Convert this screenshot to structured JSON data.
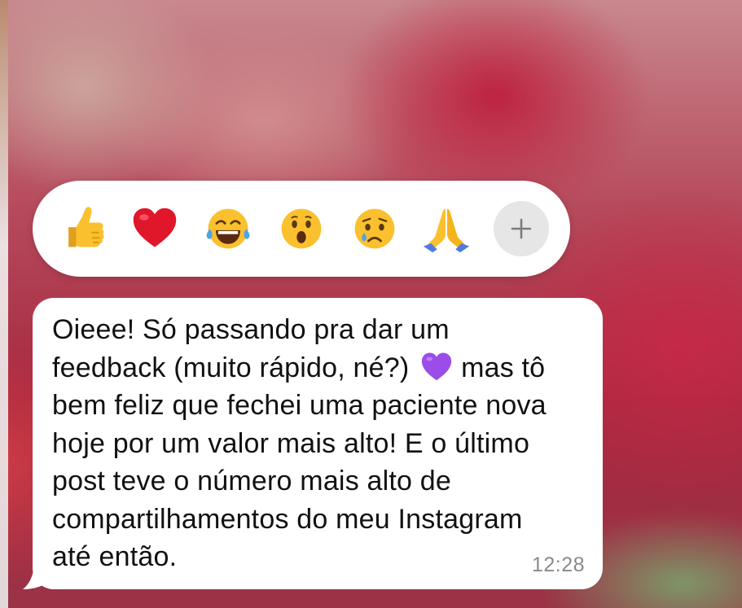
{
  "reaction_bar": {
    "reactions": [
      {
        "emoji": "👍",
        "icon": "thumbs-up-icon"
      },
      {
        "emoji": "❤️",
        "icon": "red-heart-icon"
      },
      {
        "emoji": "😂",
        "icon": "tears-of-joy-icon"
      },
      {
        "emoji": "😮",
        "icon": "surprised-face-icon"
      },
      {
        "emoji": "😢",
        "icon": "crying-face-icon"
      },
      {
        "emoji": "🙏",
        "icon": "folded-hands-icon"
      }
    ],
    "more_icon": "plus-icon"
  },
  "message": {
    "lines": [
      "Oieee! Só passando pra dar um",
      "feedback (muito rápido, né?)",
      "bem feliz que fechei uma paciente nova",
      "hoje por um valor mais alto! E o último",
      "post teve o número mais alto de",
      "compartilhamentos do meu Instagram",
      "até então."
    ],
    "line2_emoji": "💜",
    "line2_suffix": "mas tô",
    "time": "12:28"
  },
  "colors": {
    "bubble": "#ffffff",
    "time_text": "#8a8a8e",
    "more_button_bg": "#e6e6e7",
    "heart_purple": "#9b4dea",
    "heart_red": "#e0162b",
    "emoji_yellow": "#fbc02d"
  }
}
